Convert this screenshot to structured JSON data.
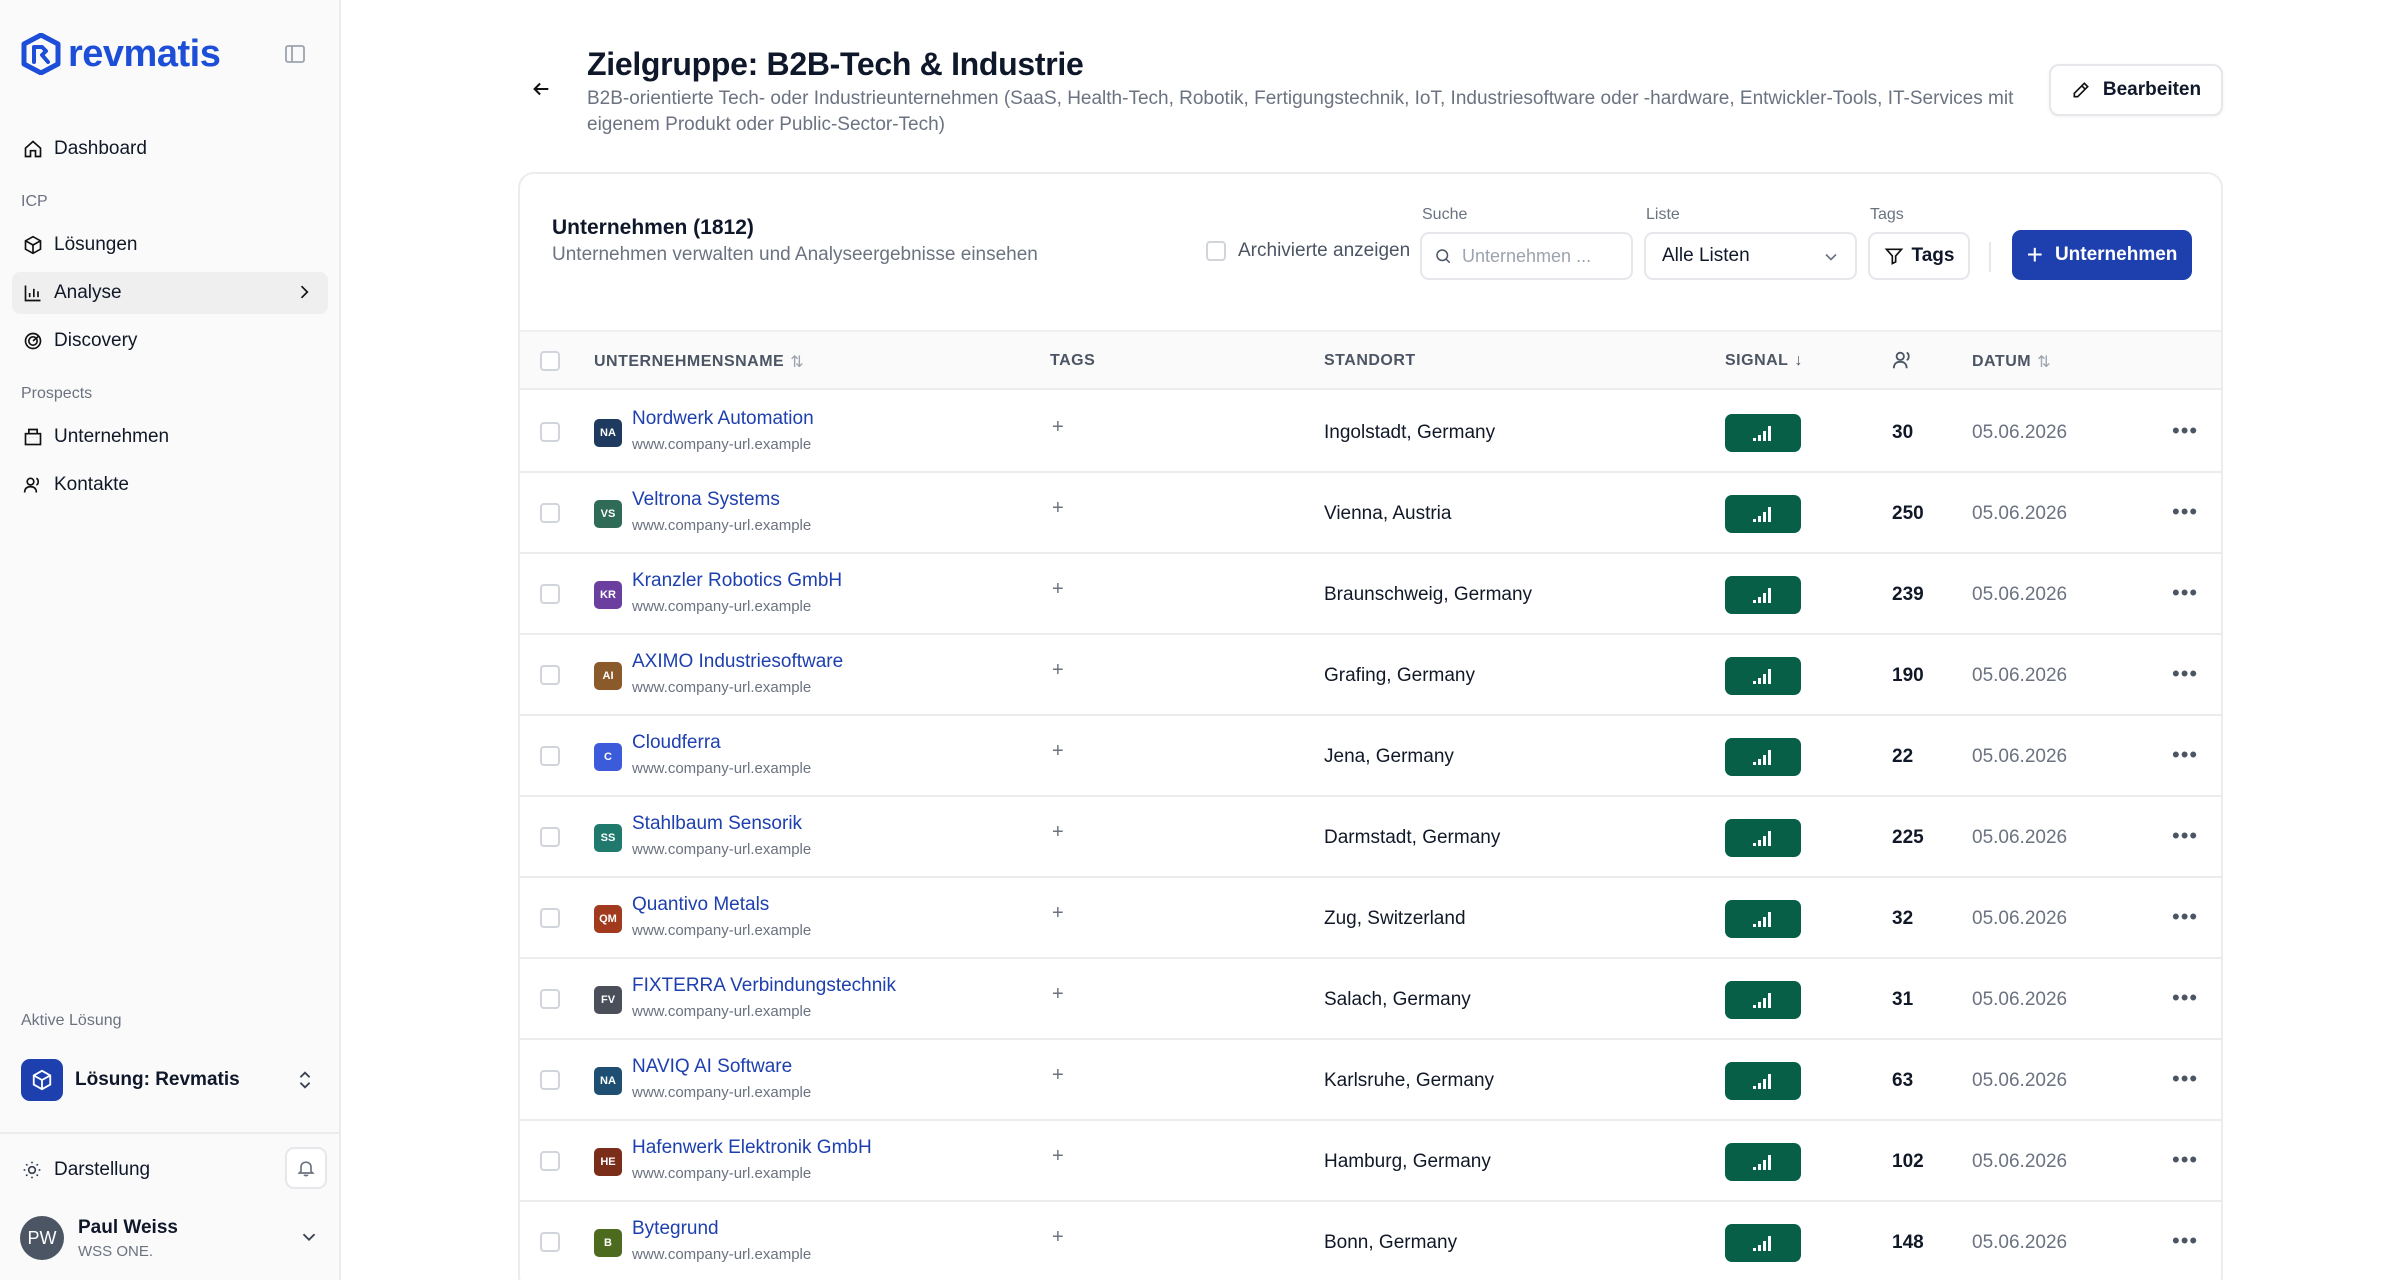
{
  "brand": {
    "name": "revmatis",
    "color": "#1d4ed8"
  },
  "sidebar": {
    "items_top": [
      {
        "label": "Dashboard",
        "icon": "home-icon"
      }
    ],
    "section_icp": "ICP",
    "items_icp": [
      {
        "label": "Lösungen",
        "icon": "package-icon"
      },
      {
        "label": "Analyse",
        "icon": "bar-chart-icon"
      },
      {
        "label": "Discovery",
        "icon": "radar-icon"
      }
    ],
    "section_prospects": "Prospects",
    "items_prospects": [
      {
        "label": "Unternehmen",
        "icon": "building-icon"
      },
      {
        "label": "Kontakte",
        "icon": "users-icon"
      }
    ],
    "active_solution_label": "Aktive Lösung",
    "active_solution": "Lösung: Revmatis",
    "appearance": "Darstellung",
    "user": {
      "initials": "PW",
      "name": "Paul Weiss",
      "org": "WSS ONE."
    }
  },
  "header": {
    "title": "Zielgruppe: B2B-Tech & Industrie",
    "description": "B2B-orientierte Tech- oder Industrieunternehmen (SaaS, Health-Tech, Robotik, Fertigungstechnik, IoT, Industriesoftware oder -hardware, Entwickler-Tools, IT-Services mit eigenem Produkt oder Public-Sector-Tech)",
    "edit_label": "Bearbeiten"
  },
  "card": {
    "title": "Unternehmen (1812)",
    "subtitle": "Unternehmen verwalten und Analyseergebnisse einsehen",
    "archived_label": "Archivierte anzeigen",
    "search_label": "Suche",
    "search_placeholder": "Unternehmen ...",
    "list_label": "Liste",
    "list_value": "Alle Listen",
    "tags_label": "Tags",
    "tags_button": "Tags",
    "add_button": "Unternehmen"
  },
  "table": {
    "columns": {
      "name": "UNTERNEHMENSNAME",
      "tags": "TAGS",
      "location": "STANDORT",
      "signal": "SIGNAL",
      "date": "DATUM"
    },
    "signal_color": "#065f46",
    "rows": [
      {
        "initials": "NA",
        "color": "#1e3a5f",
        "name": "Nordwerk Automation",
        "url": "www.company-url.example",
        "tags": "+",
        "location": "Ingolstadt, Germany",
        "count": "30",
        "date": "05.06.2026"
      },
      {
        "initials": "VS",
        "color": "#2f6b57",
        "name": "Veltrona Systems",
        "url": "www.company-url.example",
        "tags": "+",
        "location": "Vienna, Austria",
        "count": "250",
        "date": "05.06.2026"
      },
      {
        "initials": "KR",
        "color": "#6b3fa0",
        "name": "Kranzler Robotics GmbH",
        "url": "www.company-url.example",
        "tags": "+",
        "location": "Braunschweig, Germany",
        "count": "239",
        "date": "05.06.2026"
      },
      {
        "initials": "AI",
        "color": "#8a5a2b",
        "name": "AXIMO Industriesoftware",
        "url": "www.company-url.example",
        "tags": "+",
        "location": "Grafing, Germany",
        "count": "190",
        "date": "05.06.2026"
      },
      {
        "initials": "C",
        "color": "#3b5bdb",
        "name": "Cloudferra",
        "url": "www.company-url.example",
        "tags": "+",
        "location": "Jena, Germany",
        "count": "22",
        "date": "05.06.2026"
      },
      {
        "initials": "SS",
        "color": "#1f7a6d",
        "name": "Stahlbaum Sensorik",
        "url": "www.company-url.example",
        "tags": "+",
        "location": "Darmstadt, Germany",
        "count": "225",
        "date": "05.06.2026"
      },
      {
        "initials": "QM",
        "color": "#a23b1e",
        "name": "Quantivo Metals",
        "url": "www.company-url.example",
        "tags": "+",
        "location": "Zug, Switzerland",
        "count": "32",
        "date": "05.06.2026"
      },
      {
        "initials": "FV",
        "color": "#4a4f5a",
        "name": "FIXTERRA Verbindungstechnik",
        "url": "www.company-url.example",
        "tags": "+",
        "location": "Salach, Germany",
        "count": "31",
        "date": "05.06.2026"
      },
      {
        "initials": "NA",
        "color": "#1e4f73",
        "name": "NAVIQ AI Software",
        "url": "www.company-url.example",
        "tags": "+",
        "location": "Karlsruhe, Germany",
        "count": "63",
        "date": "05.06.2026"
      },
      {
        "initials": "HE",
        "color": "#7a2e1a",
        "name": "Hafenwerk Elektronik GmbH",
        "url": "www.company-url.example",
        "tags": "+",
        "location": "Hamburg, Germany",
        "count": "102",
        "date": "05.06.2026"
      },
      {
        "initials": "B",
        "color": "#4d6b1f",
        "name": "Bytegrund",
        "url": "www.company-url.example",
        "tags": "+",
        "location": "Bonn, Germany",
        "count": "148",
        "date": "05.06.2026"
      }
    ]
  }
}
